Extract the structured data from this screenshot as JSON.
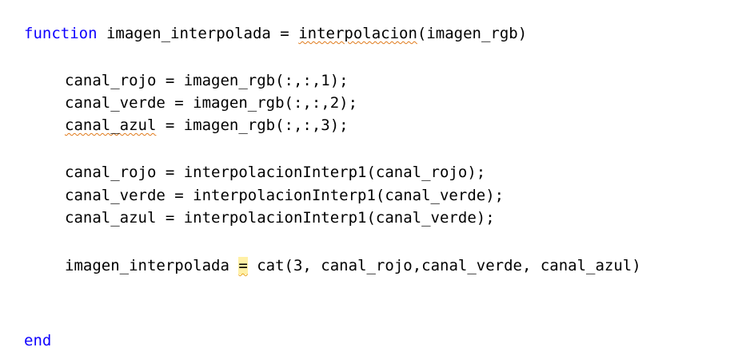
{
  "code": {
    "function_keyword": "function",
    "signature_pre": " imagen_interpolada = ",
    "signature_squiggle": "interpolacion",
    "signature_post": "(imagen_rgb)",
    "line_rojo": "canal_rojo = imagen_rgb(:,:,1);",
    "line_verde": "canal_verde = imagen_rgb(:,:,2);",
    "line_azul_var": "canal_azul",
    "line_azul_rest": " = imagen_rgb(:,:,3);",
    "interp_rojo": "canal_rojo = interpolacionInterp1(canal_rojo);",
    "interp_verde": "canal_verde = interpolacionInterp1(canal_verde);",
    "interp_azul": "canal_azul = interpolacionInterp1(canal_verde);",
    "cat_pre": "imagen_interpolada ",
    "cat_eq": "=",
    "cat_post": " cat(3, canal_rojo,canal_verde, canal_azul)",
    "end_keyword": "end"
  },
  "colors": {
    "keyword": "#0e00ff",
    "text": "#000000",
    "warning_underline": "#e07a1a",
    "warning_highlight": "#fff0a6"
  }
}
